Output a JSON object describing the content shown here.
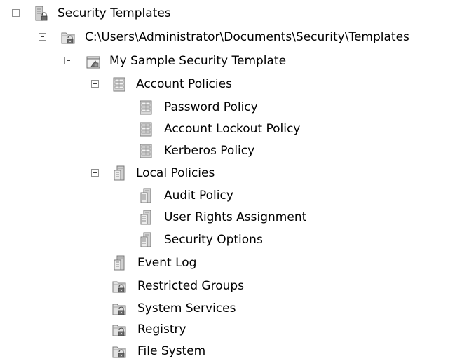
{
  "tree": {
    "root": {
      "label": "Security Templates",
      "icon": "security-templates-icon",
      "expanded": true
    },
    "folder": {
      "label": "C:\\Users\\Administrator\\Documents\\Security\\Templates",
      "icon": "locked-folder-icon",
      "expanded": true
    },
    "template": {
      "label": "My Sample Security Template",
      "icon": "template-document-icon",
      "expanded": true
    },
    "account_policies": {
      "label": "Account Policies",
      "icon": "policy-server-icon",
      "expanded": true
    },
    "password_policy": {
      "label": "Password Policy",
      "icon": "policy-server-icon"
    },
    "account_lockout_policy": {
      "label": "Account Lockout Policy",
      "icon": "policy-server-icon"
    },
    "kerberos_policy": {
      "label": "Kerberos Policy",
      "icon": "policy-server-icon"
    },
    "local_policies": {
      "label": "Local Policies",
      "icon": "policy-document-icon",
      "expanded": true
    },
    "audit_policy": {
      "label": "Audit Policy",
      "icon": "policy-document-icon"
    },
    "user_rights_assignment": {
      "label": "User Rights Assignment",
      "icon": "policy-document-icon"
    },
    "security_options": {
      "label": "Security Options",
      "icon": "policy-document-icon"
    },
    "event_log": {
      "label": "Event Log",
      "icon": "policy-document-icon"
    },
    "restricted_groups": {
      "label": "Restricted Groups",
      "icon": "locked-folder-icon"
    },
    "system_services": {
      "label": "System Services",
      "icon": "locked-folder-icon"
    },
    "registry": {
      "label": "Registry",
      "icon": "locked-folder-icon"
    },
    "file_system": {
      "label": "File System",
      "icon": "locked-folder-icon"
    }
  }
}
